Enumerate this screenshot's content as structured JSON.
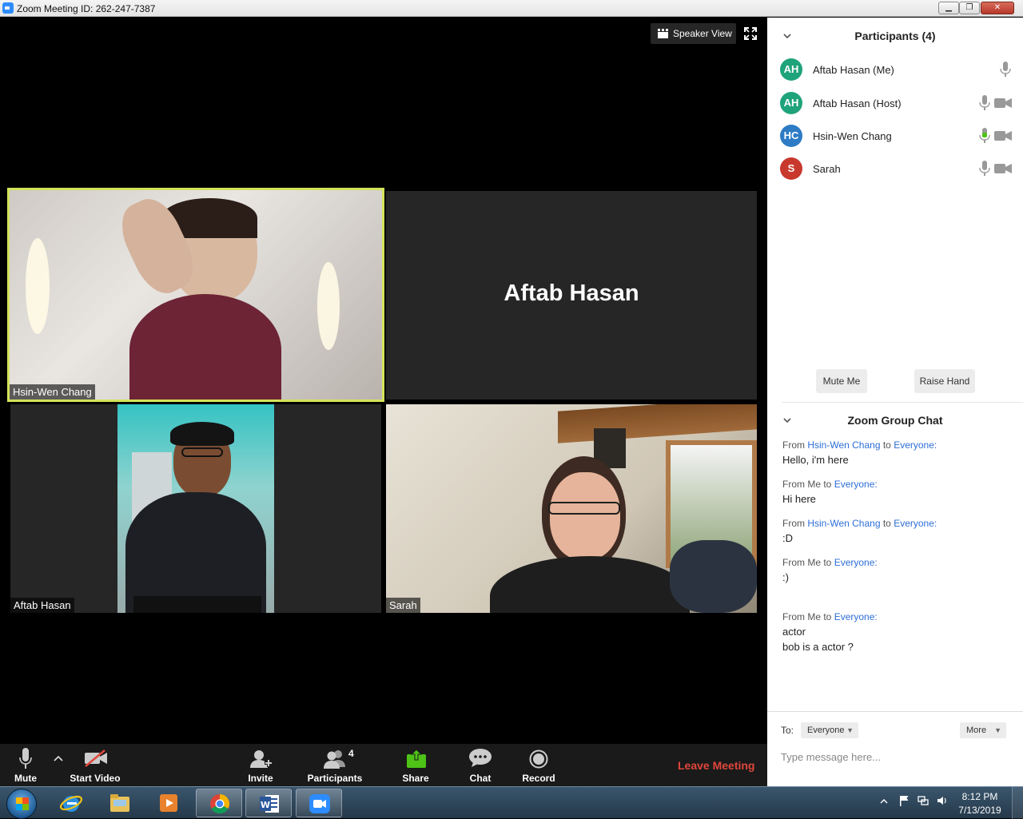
{
  "window": {
    "title": "Zoom Meeting ID: 262-247-7387",
    "controls": [
      "minimize-icon",
      "restore-icon",
      "close-icon"
    ]
  },
  "video": {
    "speaker_view_label": "Speaker View",
    "tiles": [
      {
        "name": "Hsin-Wen Chang",
        "video": true,
        "active_speaker": true,
        "highlight_color": "#d4e35a"
      },
      {
        "name": "Aftab Hasan",
        "video": false
      },
      {
        "name": "Aftab Hasan",
        "video": true
      },
      {
        "name": "Sarah",
        "video": true
      }
    ]
  },
  "toolbar": {
    "mute_label": "Mute",
    "start_video_label": "Start Video",
    "invite_label": "Invite",
    "participants_label": "Participants",
    "participants_count": "4",
    "share_label": "Share",
    "chat_label": "Chat",
    "record_label": "Record",
    "leave_label": "Leave Meeting",
    "share_color": "#4ec217",
    "leave_color": "#e0463b"
  },
  "participants": {
    "title": "Participants (4)",
    "list": [
      {
        "initials": "AH",
        "name": "Aftab Hasan (Me)",
        "color": "#1fa37a",
        "mic": "on",
        "camera": "none"
      },
      {
        "initials": "AH",
        "name": "Aftab Hasan (Host)",
        "color": "#1fa37a",
        "mic": "on",
        "camera": "off"
      },
      {
        "initials": "HC",
        "name": "Hsin-Wen Chang",
        "color": "#2d7bc4",
        "mic": "active",
        "camera": "off"
      },
      {
        "initials": "S",
        "name": "Sarah",
        "color": "#c8382d",
        "mic": "on",
        "camera": "off"
      }
    ],
    "mute_me_label": "Mute Me",
    "raise_hand_label": "Raise Hand"
  },
  "chat": {
    "title": "Zoom Group Chat",
    "messages": [
      {
        "from_prefix": "From ",
        "sender": "Hsin-Wen Chang",
        "to_word": " to ",
        "recipient": "Everyone:",
        "lines": [
          "Hello, i'm here"
        ]
      },
      {
        "from_prefix": "From Me to ",
        "recipient": "Everyone:",
        "lines": [
          "Hi here"
        ]
      },
      {
        "from_prefix": "From ",
        "sender": "Hsin-Wen Chang",
        "to_word": " to ",
        "recipient": "Everyone:",
        "lines": [
          ":D"
        ]
      },
      {
        "from_prefix": "From Me to ",
        "recipient": "Everyone:",
        "lines": [
          ":)"
        ]
      },
      {
        "from_prefix": "From Me to ",
        "recipient": "Everyone:",
        "lines": [
          "actor",
          "bob is a actor ?"
        ]
      }
    ],
    "to_label": "To:",
    "to_value": "Everyone",
    "more_label": "More",
    "input_placeholder": "Type message here..."
  },
  "taskbar": {
    "apps": [
      "internet-explorer-icon",
      "file-explorer-icon",
      "media-player-icon",
      "chrome-icon",
      "word-icon",
      "zoom-icon"
    ],
    "active_apps": [
      "chrome-icon",
      "word-icon",
      "zoom-icon"
    ],
    "time": "8:12 PM",
    "date": "7/13/2019"
  }
}
